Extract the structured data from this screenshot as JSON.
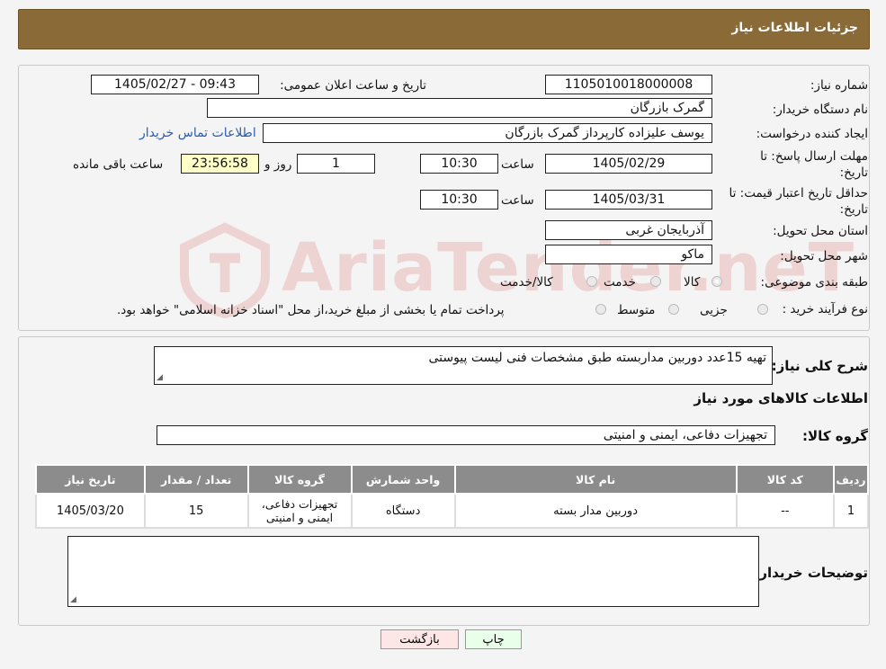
{
  "header": {
    "title": "جزئیات اطلاعات نیاز"
  },
  "watermark": {
    "text": "AriaTender.neT"
  },
  "form": {
    "need_number": {
      "label": "شماره نیاز:",
      "value": "1105010018000008"
    },
    "announce": {
      "label": "تاریخ و ساعت اعلان عمومی:",
      "value": "1405/02/27 - 09:43"
    },
    "buyer": {
      "label": "نام دستگاه خریدار:",
      "value": "گمرک بازرگان"
    },
    "creator": {
      "label": "ایجاد کننده درخواست:",
      "value": "یوسف علیزاده کارپرداز گمرک بازرگان",
      "contact_link": "اطلاعات تماس خریدار"
    },
    "deadline": {
      "label_line1": "مهلت ارسال پاسخ: تا",
      "label_line2": "تاریخ:",
      "date": "1405/02/29",
      "time_label": "ساعت",
      "time": "10:30",
      "days": "1",
      "days_label": "روز و",
      "remaining": "23:56:58",
      "remaining_label": "ساعت باقی مانده"
    },
    "validity": {
      "label_line1": "حداقل تاریخ اعتبار قیمت: تا",
      "label_line2": "تاریخ:",
      "date": "1405/03/31",
      "time_label": "ساعت",
      "time": "10:30"
    },
    "province": {
      "label": "استان محل تحویل:",
      "value": "آذربایجان غربی"
    },
    "city": {
      "label": "شهر محل تحویل:",
      "value": "ماکو"
    },
    "category": {
      "label": "طبقه بندی موضوعی:",
      "options": [
        "کالا",
        "خدمت",
        "کالا/خدمت"
      ],
      "selected": "کالا"
    },
    "process": {
      "label": "نوع فرآیند خرید :",
      "options": [
        "جزیی",
        "متوسط"
      ],
      "note": "پرداخت تمام یا بخشی از مبلغ خرید،از محل \"اسناد خزانه اسلامی\" خواهد بود."
    }
  },
  "description": {
    "label": "شرح کلی نیاز:",
    "value": "تهیه 15عدد دوربین مداربسته طبق مشخصات فنی لیست پیوستی"
  },
  "goods": {
    "section_title": "اطلاعات کالاهای مورد نیاز",
    "group_label": "گروه کالا:",
    "group_value": "تجهیزات دفاعی، ایمنی و امنیتی",
    "columns": [
      "ردیف",
      "کد کالا",
      "نام کالا",
      "واحد شمارش",
      "گروه کالا",
      "تعداد / مقدار",
      "تاریخ نیاز"
    ],
    "rows": [
      [
        "1",
        "--",
        "دوربین مدار بسته",
        "دستگاه",
        "تجهیزات دفاعی، ایمنی و امنیتی",
        "15",
        "1405/03/20"
      ]
    ]
  },
  "buyer_notes": {
    "label": "توضیحات خریدار:",
    "value": ""
  },
  "buttons": {
    "print": "چاپ",
    "back": "بازگشت"
  },
  "colors": {
    "header_bg": "#8a6b38",
    "link": "#2a5db0",
    "back_btn": "#ffe6e6",
    "print_btn": "#eaffea",
    "table_header": "#8c8c8c"
  }
}
